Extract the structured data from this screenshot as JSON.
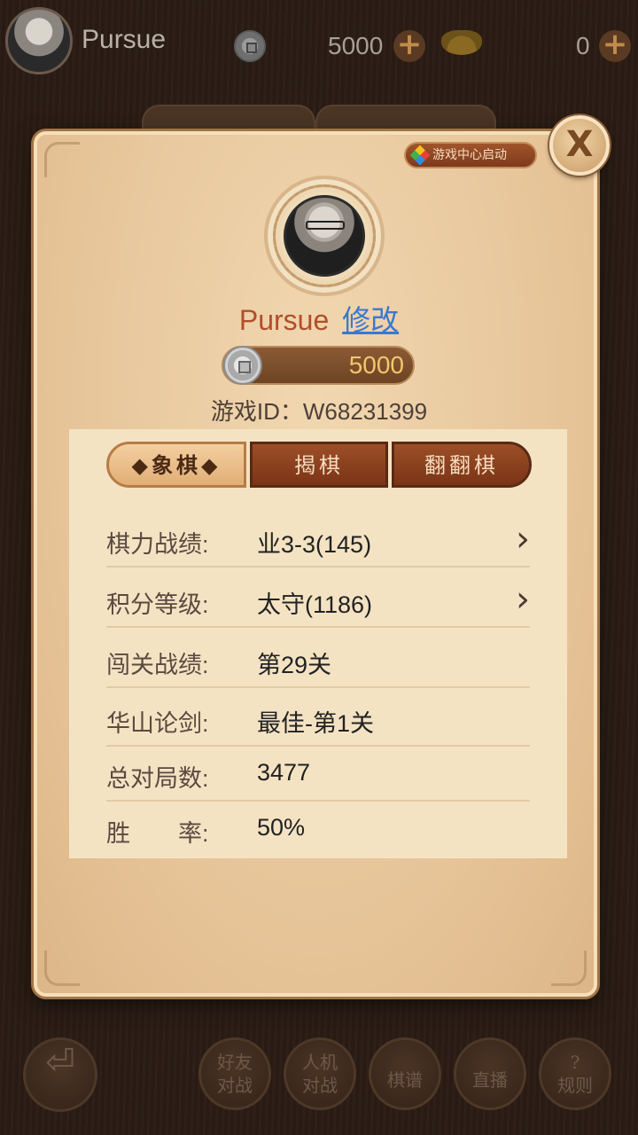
{
  "topbar": {
    "player_name": "Pursue",
    "coins": "5000",
    "gold": "0",
    "plus_symbol": "+"
  },
  "bottom_bar": {
    "back_icon": "⏎",
    "buttons": [
      {
        "line1": "好友",
        "line2": "对战"
      },
      {
        "line1": "人机",
        "line2": "对战"
      },
      {
        "line1": "棋谱",
        "line2": ""
      },
      {
        "line1": "直播",
        "line2": ""
      },
      {
        "line1": "?",
        "line2": "规则"
      }
    ]
  },
  "panel": {
    "badge": "游戏中心启动",
    "close_symbol": "X",
    "player_name": "Pursue",
    "edit_label": "修改",
    "coin_amount": "5000",
    "game_id": "游戏ID：W68231399",
    "tabs": [
      "◆象棋◆",
      "揭棋",
      "翻翻棋"
    ],
    "stats": [
      {
        "label": "棋力战绩:",
        "value": "业3-3(145)",
        "has_arrow": true
      },
      {
        "label": "积分等级:",
        "value": "太守(1186)",
        "has_arrow": true
      },
      {
        "label": "闯关战绩:",
        "value": "第29关",
        "has_arrow": false
      },
      {
        "label": "华山论剑:",
        "value": "最佳-第1关",
        "has_arrow": false
      },
      {
        "label": "总对局数:",
        "value": "3477",
        "has_arrow": false
      },
      {
        "label": "胜　　率:",
        "value": "50%",
        "has_arrow": false
      }
    ],
    "arrow_symbol": "›"
  },
  "colors": {
    "panel_bg": "#e9caa0",
    "name_color": "#b24e2a",
    "edit_link": "#3b78d0",
    "coin_text": "#f3c66e",
    "tab_active": "#e1ae76",
    "tab_inactive": "#7b3417"
  }
}
